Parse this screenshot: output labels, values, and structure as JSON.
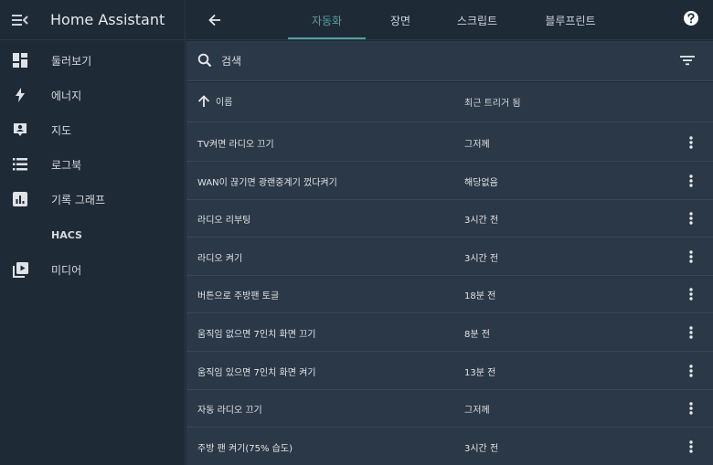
{
  "sidebar": {
    "title": "Home Assistant",
    "items": [
      {
        "label": "둘러보기",
        "icon": "dashboard-icon"
      },
      {
        "label": "에너지",
        "icon": "lightning-icon"
      },
      {
        "label": "지도",
        "icon": "map-account-icon"
      },
      {
        "label": "로그북",
        "icon": "list-icon"
      },
      {
        "label": "기록 그래프",
        "icon": "bar-chart-icon"
      },
      {
        "label": "HACS",
        "icon": ""
      },
      {
        "label": "미디어",
        "icon": "media-play-icon"
      }
    ]
  },
  "tabs": [
    {
      "label": "자동화",
      "active": true
    },
    {
      "label": "장면",
      "active": false
    },
    {
      "label": "스크립트",
      "active": false
    },
    {
      "label": "블루프린트",
      "active": false
    }
  ],
  "search": {
    "placeholder": "검색"
  },
  "table": {
    "columns": {
      "name": "이름",
      "last_triggered": "최근 트리거 됨"
    },
    "rows": [
      {
        "name": "TV켜면 라디오 끄기",
        "last_triggered": "그저께"
      },
      {
        "name": "WAN이 끊기면 광랜중계기 껐다켜기",
        "last_triggered": "해당없음"
      },
      {
        "name": "라디오 리부팅",
        "last_triggered": "3시간 전"
      },
      {
        "name": "라디오 켜기",
        "last_triggered": "3시간 전"
      },
      {
        "name": "버튼으로 주방팬 토글",
        "last_triggered": "18분 전"
      },
      {
        "name": "움직임 없으면 7인치 화면 끄기",
        "last_triggered": "8분 전"
      },
      {
        "name": "움직임 있으면 7인치 화면 켜기",
        "last_triggered": "13분 전"
      },
      {
        "name": "자동 라디오 끄기",
        "last_triggered": "그저께"
      },
      {
        "name": "주방 팬 켜기(75% 습도)",
        "last_triggered": "3시간 전"
      }
    ]
  },
  "colors": {
    "accent": "#4fa3a0",
    "background": "#1f2a37",
    "panel": "#2b3847"
  }
}
